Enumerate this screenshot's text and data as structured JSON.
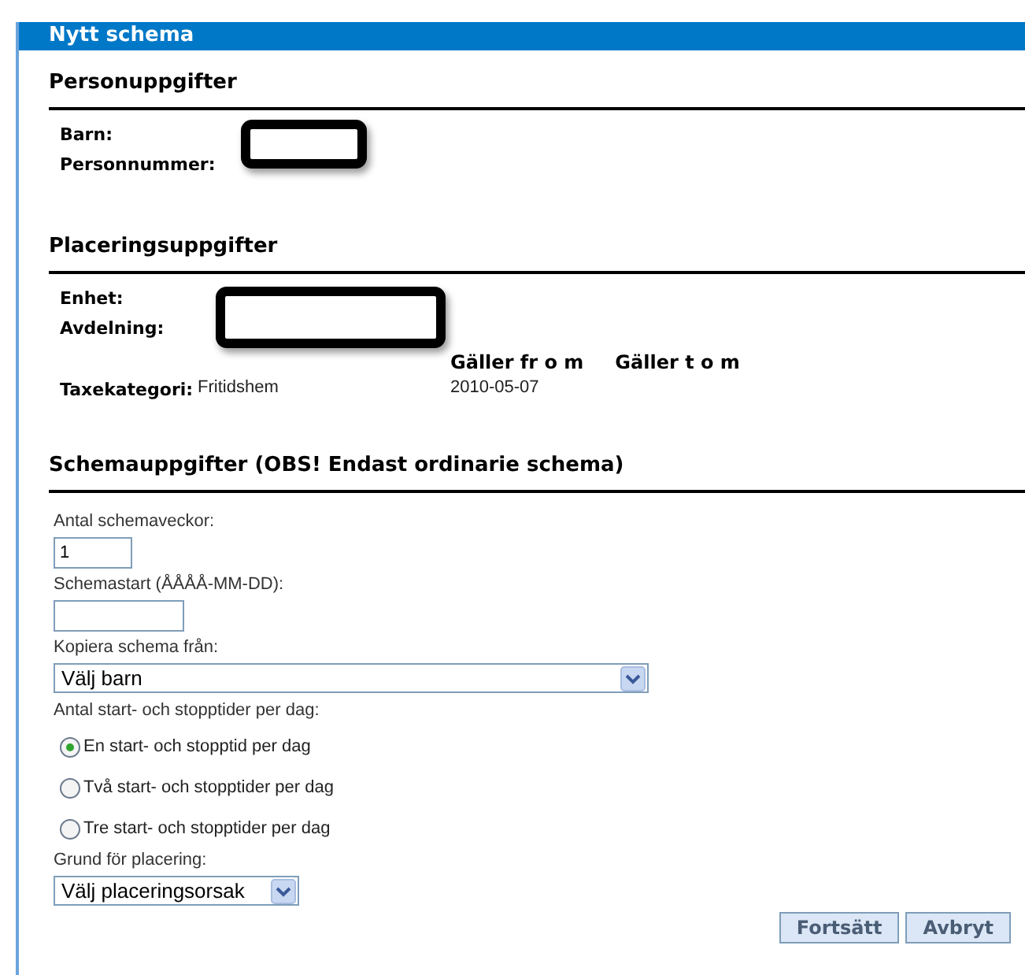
{
  "window": {
    "title": "Nytt schema"
  },
  "person": {
    "heading": "Personuppgifter",
    "labels": [
      "Barn:",
      "Personnummer:"
    ]
  },
  "placement": {
    "heading": "Placeringsuppgifter",
    "labels": [
      "Enhet:",
      "Avdelning:"
    ],
    "columns": [
      "Gäller fr o m",
      "Gäller t o m"
    ],
    "category_label": "Taxekategori:",
    "category_value": "Fritidshem",
    "valid_from": "2010-05-07"
  },
  "schedule": {
    "heading": "Schemauppgifter (OBS! Endast ordinarie schema)",
    "weeks": {
      "label": "Antal schemaveckor:",
      "value": "1"
    },
    "start": {
      "label": "Schemastart (ÅÅÅÅ-MM-DD):"
    },
    "copy": {
      "label": "Kopiera schema från:",
      "value": "Välj barn"
    },
    "times_label": "Antal start- och stopptider per dag:",
    "times": [
      {
        "label": "En start- och stopptid per dag",
        "selected": true
      },
      {
        "label": "Två start- och stopptider per dag",
        "selected": false
      },
      {
        "label": "Tre start- och stopptider per dag",
        "selected": false
      }
    ],
    "reason": {
      "label": "Grund för placering:",
      "value": "Välj placeringsorsak"
    }
  },
  "buttons": [
    "Fortsätt",
    "Avbryt"
  ]
}
